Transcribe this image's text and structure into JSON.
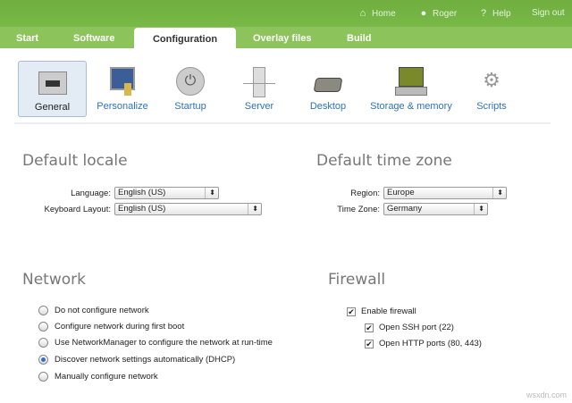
{
  "topnav": {
    "home": "Home",
    "user": "Roger",
    "help": "Help",
    "signout": "Sign out"
  },
  "tabs": [
    "Start",
    "Software",
    "Configuration",
    "Overlay files",
    "Build"
  ],
  "tools": [
    "General",
    "Personalize",
    "Startup",
    "Server",
    "Desktop",
    "Storage & memory",
    "Scripts"
  ],
  "locale": {
    "title": "Default locale",
    "language_label": "Language:",
    "language": "English (US)",
    "keyboard_label": "Keyboard Layout:",
    "keyboard": "English (US)"
  },
  "timezone": {
    "title": "Default time zone",
    "region_label": "Region:",
    "region": "Europe",
    "tz_label": "Time Zone:",
    "tz": "Germany"
  },
  "network": {
    "title": "Network",
    "options": [
      "Do not configure network",
      "Configure network during first boot",
      "Use NetworkManager to configure the network at run-time",
      "Discover network settings automatically (DHCP)",
      "Manually configure network"
    ],
    "selected": 3
  },
  "firewall": {
    "title": "Firewall",
    "enable": "Enable firewall",
    "ssh": "Open SSH port (22)",
    "http": "Open HTTP ports (80, 443)"
  },
  "watermark": "wsxdn.com"
}
